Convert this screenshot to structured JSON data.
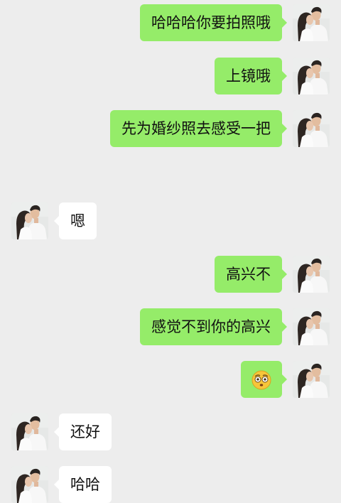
{
  "conversation": {
    "messages": [
      {
        "from": "me",
        "text": "哈哈哈你要拍照哦"
      },
      {
        "from": "me",
        "text": "上镜哦"
      },
      {
        "from": "me",
        "text": "先为婚纱照去感受一把"
      },
      {
        "from": "other",
        "text": "嗯"
      },
      {
        "from": "me",
        "text": "高兴不"
      },
      {
        "from": "me",
        "text": "感觉不到你的高兴"
      },
      {
        "from": "me",
        "emoji": "wide-eyed-emoji-icon"
      },
      {
        "from": "other",
        "text": "还好"
      },
      {
        "from": "other",
        "text": "哈哈"
      }
    ]
  },
  "colors": {
    "background": "#ededed",
    "sent_bubble": "#95ec69",
    "received_bubble": "#ffffff"
  }
}
